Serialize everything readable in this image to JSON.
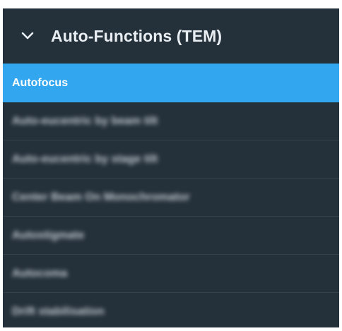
{
  "panel": {
    "header": {
      "title": "Auto-Functions (TEM)",
      "icon": "chevron-down-icon"
    },
    "items": [
      {
        "label": "Autofocus",
        "selected": true
      },
      {
        "label": "Auto-eucentric by beam tilt",
        "selected": false
      },
      {
        "label": "Auto-eucentric by stage tilt",
        "selected": false
      },
      {
        "label": "Center Beam On Monochromator",
        "selected": false
      },
      {
        "label": "Autostigmate",
        "selected": false
      },
      {
        "label": "Autocoma",
        "selected": false
      },
      {
        "label": "Drift stabilisation",
        "selected": false
      }
    ]
  },
  "colors": {
    "panel_background": "#24303a",
    "selected_item": "#32a6ef",
    "text": "#e9eef2"
  }
}
